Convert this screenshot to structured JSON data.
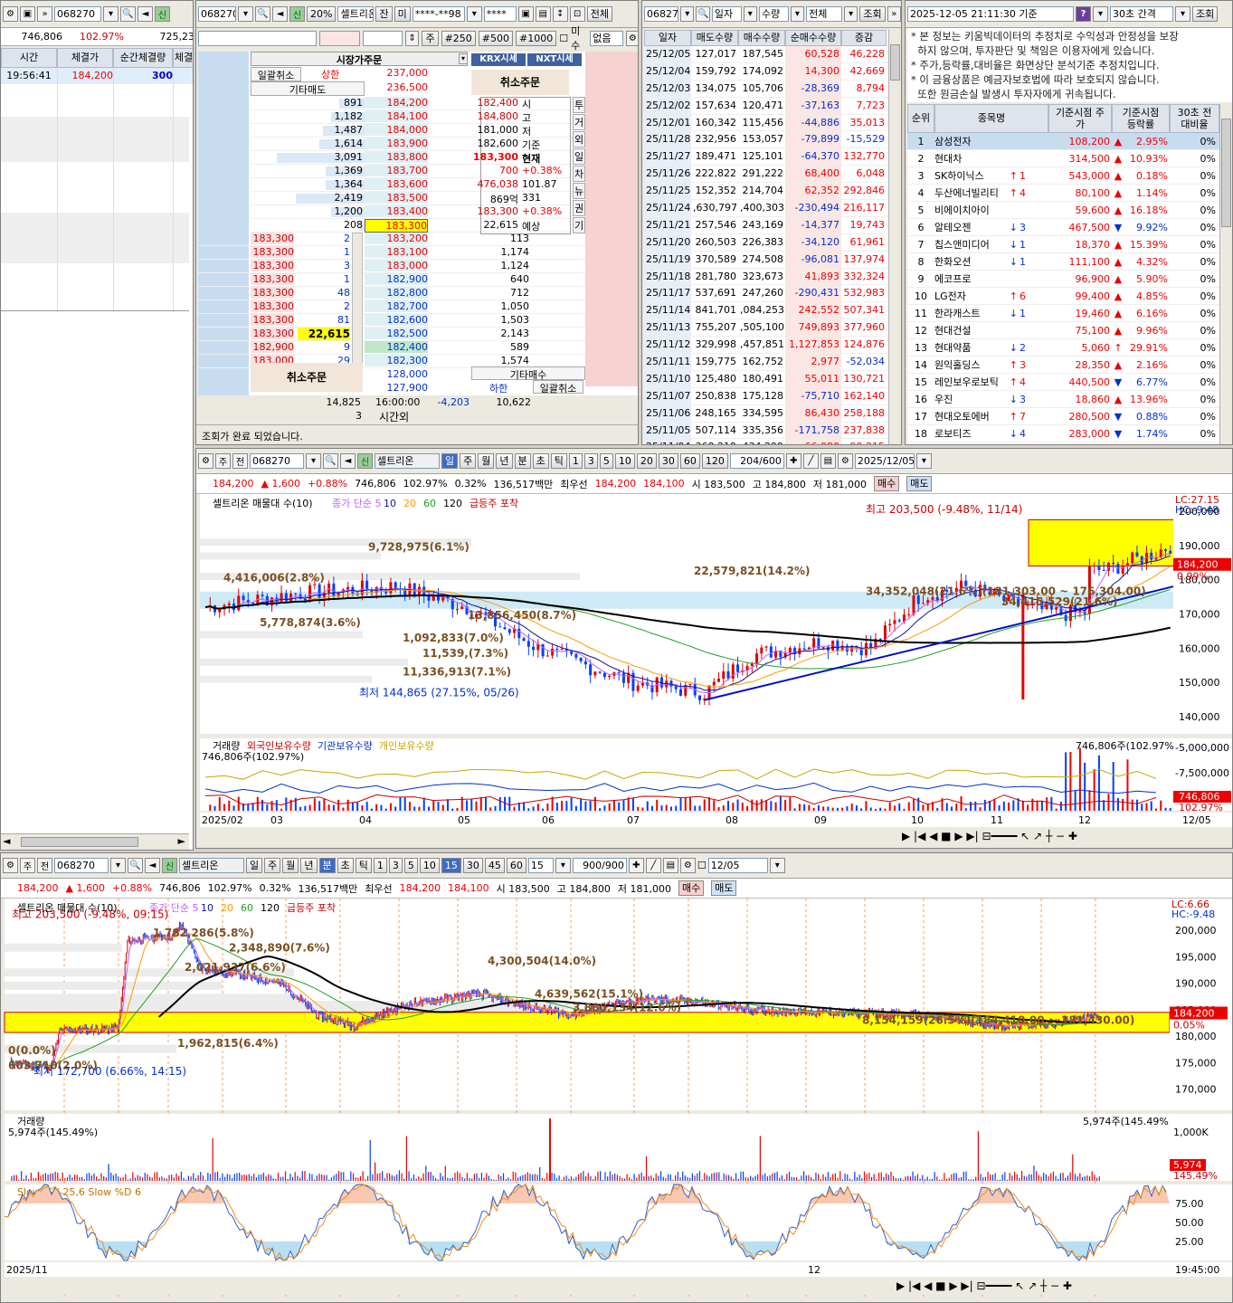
{
  "ticks": {
    "code": "068270",
    "summary": [
      "746,806",
      "102.97%",
      "725,23"
    ],
    "headers": [
      "시간",
      "체결가",
      "순간체결량",
      "체결"
    ],
    "rows": [
      {
        "time": "19:56:41",
        "price": "184,200",
        "qty": "300"
      }
    ]
  },
  "order": {
    "code": "068270",
    "name": "셀트리온",
    "pct_btn": "20%",
    "tabs": [
      "신",
      "잔",
      "미"
    ],
    "acct": "****-**98",
    "pw": "****",
    "all_btn": "전체",
    "presets": [
      "주",
      "#250",
      "#500",
      "#1000"
    ],
    "unfilled": "미수",
    "none": "없음",
    "market_order": "시장가주문",
    "krx": "KRX시세",
    "nxt": "NXT시세",
    "cancel_all": "일괄취소",
    "upper_label": "상한",
    "upper": "237,000",
    "other_sell": "기타매도",
    "other_sell_px": "236,500",
    "cancel_order": "취소주문",
    "asks": [
      {
        "q": "891",
        "p": "184,200"
      },
      {
        "q": "1,182",
        "p": "184,100"
      },
      {
        "q": "1,487",
        "p": "184,000"
      },
      {
        "q": "1,614",
        "p": "183,900"
      },
      {
        "q": "3,091",
        "p": "183,800"
      },
      {
        "q": "1,369",
        "p": "183,700"
      },
      {
        "q": "1,364",
        "p": "183,600"
      },
      {
        "q": "2,419",
        "p": "183,500"
      },
      {
        "q": "1,200",
        "p": "183,400"
      },
      {
        "q": "208",
        "p": "183,300"
      }
    ],
    "info": [
      {
        "v": "182,400",
        "l": "시"
      },
      {
        "v": "184,800",
        "l": "고"
      },
      {
        "v": "181,000",
        "l": "저"
      },
      {
        "v": "182,600",
        "l": "기준"
      },
      {
        "v": "183,300",
        "l": "현재"
      },
      {
        "v": "700",
        "l": "+0.38%"
      },
      {
        "v": "476,038",
        "l": "101.87"
      },
      {
        "v": "869억",
        "l": "331"
      },
      {
        "v": "183,300",
        "l": "+0.38%"
      },
      {
        "v": "22,615",
        "l": "예상"
      }
    ],
    "side_tabs": [
      "투",
      "거",
      "외",
      "일",
      "차",
      "뉴",
      "권",
      "기"
    ],
    "bids": [
      {
        "b": "183,300",
        "q": "2",
        "p": "183,200",
        "r": "113"
      },
      {
        "b": "183,300",
        "q": "1",
        "p": "183,100",
        "r": "1,174"
      },
      {
        "b": "183,300",
        "q": "3",
        "p": "183,000",
        "r": "1,124"
      },
      {
        "b": "183,300",
        "q": "1",
        "p": "182,900",
        "r": "640"
      },
      {
        "b": "183,300",
        "q": "48",
        "p": "182,800",
        "r": "712"
      },
      {
        "b": "183,300",
        "q": "2",
        "p": "182,700",
        "r": "1,050"
      },
      {
        "b": "183,300",
        "q": "81",
        "p": "182,600",
        "r": "1,503"
      },
      {
        "b": "183,300",
        "q": "22,615",
        "p": "182,500",
        "r": "2,143"
      },
      {
        "b": "182,900",
        "q": "9",
        "p": "182,400",
        "r": "589"
      },
      {
        "b": "183,000",
        "q": "29",
        "p": "182,300",
        "r": "1,574"
      }
    ],
    "other_buy_px": "128,000",
    "other_buy": "기타매수",
    "lower_px": "127,900",
    "lower_label": "하한",
    "cancel_all2": "일괄취소",
    "tot_ask": "14,825",
    "tot_time": "16:00:00",
    "tot_diff": "-4,203",
    "tot_bid": "10,622",
    "after_num": "3",
    "after": "시간외",
    "status": "조회가 완료 되었습니다."
  },
  "daily": {
    "code": "068270",
    "mode": "일자",
    "kind": "수량",
    "filter": "전체",
    "query": "조회",
    "headers": [
      "일자",
      "매도수량",
      "매수수량",
      "순매수수량",
      "증감"
    ],
    "rows": [
      [
        "25/12/05",
        "127,017",
        "187,545",
        "60,528",
        "46,228"
      ],
      [
        "25/12/04",
        "159,792",
        "174,092",
        "14,300",
        "42,669"
      ],
      [
        "25/12/03",
        "134,075",
        "105,706",
        "-28,369",
        "8,794"
      ],
      [
        "25/12/02",
        "157,634",
        "120,471",
        "-37,163",
        "7,723"
      ],
      [
        "25/12/01",
        "160,342",
        "115,456",
        "-44,886",
        "35,013"
      ],
      [
        "25/11/28",
        "232,956",
        "153,057",
        "-79,899",
        "-15,529"
      ],
      [
        "25/11/27",
        "189,471",
        "125,101",
        "-64,370",
        "132,770"
      ],
      [
        "25/11/26",
        "222,822",
        "291,222",
        "68,400",
        "6,048"
      ],
      [
        "25/11/25",
        "152,352",
        "214,704",
        "62,352",
        "292,846"
      ],
      [
        "25/11/24",
        ",630,797",
        ",400,303",
        "-230,494",
        "216,117"
      ],
      [
        "25/11/21",
        "257,546",
        "243,169",
        "-14,377",
        "19,743"
      ],
      [
        "25/11/20",
        "260,503",
        "226,383",
        "-34,120",
        "61,961"
      ],
      [
        "25/11/19",
        "370,589",
        "274,508",
        "-96,081",
        "137,974"
      ],
      [
        "25/11/18",
        "281,780",
        "323,673",
        "41,893",
        "332,324"
      ],
      [
        "25/11/17",
        "537,691",
        "247,260",
        "-290,431",
        "532,983"
      ],
      [
        "25/11/14",
        "841,701",
        ",084,253",
        "242,552",
        "507,341"
      ],
      [
        "25/11/13",
        "755,207",
        ",505,100",
        "749,893",
        "377,960"
      ],
      [
        "25/11/12",
        "329,998",
        ",457,851",
        "1,127,853",
        "124,876"
      ],
      [
        "25/11/11",
        "159,775",
        "162,752",
        "2,977",
        "-52,034"
      ],
      [
        "25/11/10",
        "125,480",
        "180,491",
        "55,011",
        "130,721"
      ],
      [
        "25/11/07",
        "250,838",
        "175,128",
        "-75,710",
        "162,140"
      ],
      [
        "25/11/06",
        "248,165",
        "334,595",
        "86,430",
        "258,188"
      ],
      [
        "25/11/05",
        "507,114",
        "335,356",
        "-171,758",
        "237,838"
      ],
      [
        "25/11/04",
        "368,219",
        "434,299",
        "66,080",
        "90,215"
      ]
    ]
  },
  "rank": {
    "datetime": "2025-12-05 21:11:30 기준",
    "interval": "30초 간격",
    "query": "조회",
    "notes": [
      "* 본 정보는 키움빅데이터의 추정치로 수익성과 안정성을 보장",
      "  하지 않으며, 투자판단 및 책임은 이용자에게 있습니다.",
      "* 주가,등락률,대비율은 화면상단 분석기준 추정치입니다.",
      "* 이 금융상품은 예금자보호법에 따라 보호되지 않습니다.",
      "  또한 원금손실 발생시 투자자에게 귀속됩니다."
    ],
    "headers": [
      "순위",
      "종목명",
      "기준시점 주가",
      "기준시점 등락률",
      "30초 전 대비율"
    ],
    "rows": [
      [
        "1",
        "삼성전자",
        "",
        "",
        "108,200",
        "▲",
        "2.95%",
        "0%"
      ],
      [
        "2",
        "현대차",
        "",
        "",
        "314,500",
        "▲",
        "10.93%",
        "0%"
      ],
      [
        "3",
        "SK하이닉스",
        "↑",
        "1",
        "543,000",
        "▲",
        "0.18%",
        "0%"
      ],
      [
        "4",
        "두산에너빌리티",
        "↑",
        "4",
        "80,100",
        "▲",
        "1.14%",
        "0%"
      ],
      [
        "5",
        "비에이치아이",
        "",
        "",
        "59,600",
        "▲",
        "16.18%",
        "0%"
      ],
      [
        "6",
        "알테오젠",
        "↓",
        "3",
        "467,500",
        "▼",
        "9.92%",
        "0%"
      ],
      [
        "7",
        "칩스앤미디어",
        "↓",
        "1",
        "18,370",
        "▲",
        "15.39%",
        "0%"
      ],
      [
        "8",
        "한화오션",
        "↓",
        "1",
        "111,100",
        "▲",
        "4.32%",
        "0%"
      ],
      [
        "9",
        "에코프로",
        "",
        "",
        "96,900",
        "▲",
        "5.90%",
        "0%"
      ],
      [
        "10",
        "LG전자",
        "↑",
        "6",
        "99,400",
        "▲",
        "4.85%",
        "0%"
      ],
      [
        "11",
        "한라캐스트",
        "↓",
        "1",
        "19,460",
        "▲",
        "6.16%",
        "0%"
      ],
      [
        "12",
        "현대건설",
        "",
        "",
        "75,100",
        "▲",
        "9.96%",
        "0%"
      ],
      [
        "13",
        "현대약품",
        "↓",
        "2",
        "5,060",
        "↑",
        "29.91%",
        "0%"
      ],
      [
        "14",
        "원익홀딩스",
        "↑",
        "3",
        "28,350",
        "▲",
        "2.16%",
        "0%"
      ],
      [
        "15",
        "레인보우로보틱",
        "↑",
        "4",
        "440,500",
        "▼",
        "6.77%",
        "0%"
      ],
      [
        "16",
        "우진",
        "↓",
        "3",
        "18,860",
        "▲",
        "13.96%",
        "0%"
      ],
      [
        "17",
        "현대오토에버",
        "↑",
        "7",
        "280,500",
        "▼",
        "0.88%",
        "0%"
      ],
      [
        "18",
        "로보티즈",
        "↓",
        "4",
        "283,000",
        "▼",
        "1.74%",
        "0%"
      ]
    ]
  },
  "chart1": {
    "toolbar": {
      "code": "068270",
      "name": "셀트리온",
      "periods": [
        "일",
        "주",
        "월",
        "년",
        "분",
        "초",
        "틱"
      ],
      "nums": [
        "1",
        "3",
        "5",
        "10",
        "20",
        "30",
        "60",
        "120"
      ],
      "count": "204/600",
      "date": "2025/12/05"
    },
    "quote": {
      "price": "184,200",
      "diff": "1,600",
      "pct": "+0.88%",
      "vol": "746,806",
      "vr": "102.97%",
      "turn": "0.32%",
      "amt": "136,517백만",
      "best_label": "최우선",
      "best_ask": "184,200",
      "best_bid": "184,100",
      "o_label": "시",
      "o": "183,500",
      "h_label": "고",
      "h": "184,800",
      "l_label": "저",
      "l": "181,000",
      "sell": "매수",
      "buy": "매도"
    },
    "legend": [
      "셀트리온 매물대 수(10)",
      "종가 단순 5",
      "10",
      "20",
      "60",
      "120",
      "급등주 포착"
    ],
    "right_top": [
      "LC:27.15",
      "HC:-9.48"
    ],
    "yticks": [
      "200,000",
      "190,000",
      "180,000",
      "170,000",
      "160,000",
      "150,000",
      "140,000"
    ],
    "price_tag": "184,200",
    "pct_tag": "0.99%",
    "ann": [
      "4,416,006(2.8%)",
      "9,728,975(6.1%)",
      "5,778,874(3.6%)",
      "22,579,821(14.2%)",
      "13,856,450(8.7%)",
      "34,352,048(21.6%)(181,303.00 ~ 176,304.00)",
      "34,415,529(21.6%)",
      "1,092,833(7.0%)",
      "11,539,(7.3%)",
      "11,336,913(7.1%)",
      "최고 203,500 (-9.48%, 11/14)",
      "최저 144,865 (27.15%, 05/26)"
    ],
    "vol_legend": [
      "거래량",
      "외국인보유수량",
      "기관보유수량",
      "개인보유수량"
    ],
    "vol_left": "746,806주(102.97%)",
    "vol_right": "746,806주(102.97%)",
    "vol_ticks": [
      "-5,000,000",
      "-7,500,000"
    ],
    "vol_tag": "746,806",
    "vol_pct": "102.97%",
    "xticks": [
      "2025/02",
      "03",
      "04",
      "05",
      "06",
      "07",
      "08",
      "09",
      "10",
      "11",
      "12"
    ],
    "x_end": "12/05"
  },
  "chart2": {
    "toolbar": {
      "code": "068270",
      "name": "셀트리온",
      "periods": [
        "일",
        "주",
        "월",
        "년",
        "분",
        "초",
        "틱"
      ],
      "nums": [
        "1",
        "3",
        "5",
        "10",
        "15",
        "30",
        "45",
        "60"
      ],
      "unit": "15",
      "count": "900/900",
      "date": "12/05"
    },
    "quote": {
      "price": "184,200",
      "diff": "1,600",
      "pct": "+0.88%",
      "vol": "746,806",
      "vr": "102.97%",
      "turn": "0.32%",
      "amt": "136,517백만",
      "best_label": "최우선",
      "best_ask": "184,200",
      "best_bid": "184,100",
      "o_label": "시",
      "o": "183,500",
      "h_label": "고",
      "h": "184,800",
      "l_label": "저",
      "l": "181,000",
      "sell": "매수",
      "buy": "매도"
    },
    "legend": [
      "셀트리온 매물대 수(10)",
      "종가 단순 5",
      "10",
      "20",
      "60",
      "120",
      "급등주 포착"
    ],
    "right_top": [
      "LC:6.66",
      "HC:-9.48"
    ],
    "yticks": [
      "200,000",
      "195,000",
      "190,000",
      "185,000",
      "180,000",
      "175,000",
      "170,000"
    ],
    "price_tag": "184,200",
    "pct_tag": "0.05%",
    "ann": [
      "최고 203,500 (-9.48%, 09:15)",
      "1,782,286(5.8%)",
      "2,348,890(7.6%)",
      "2,021,937(6.6%)",
      "4,300,504(14.0%)",
      "4,639,562(15.1%)",
      "3,880,134(12.6%)",
      "8,154,159(26.5%)(184,410.00 ~ 181,430.00)",
      "1,962,815(6.4%)",
      "0(0.0%)",
      "603,710(2.0%)",
      "최저 172,700 (6.66%, 14:15)"
    ],
    "vol_label": "거래량",
    "vol_left": "5,974주(145.49%)",
    "vol_right": "5,974주(145.49%)",
    "vol_tick": "1,000K",
    "vol_tag": "5,974",
    "vol_pct": "145.49%",
    "stoch_label": "Slow %K 25,6  Slow %D 6",
    "stoch_ticks": [
      "75.00",
      "50.00",
      "25.00"
    ],
    "xticks": [
      "2025/11",
      "12"
    ],
    "x_end": "19:45:00"
  }
}
